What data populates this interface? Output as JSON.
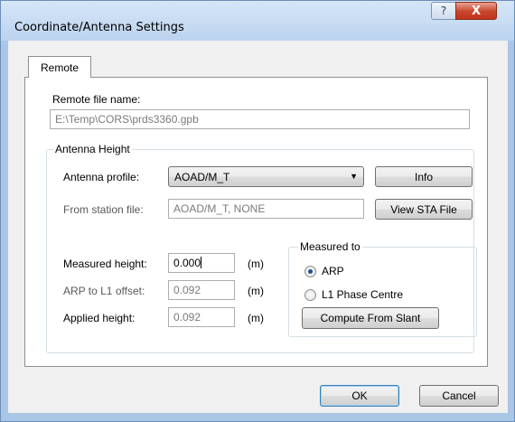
{
  "window": {
    "title": "Coordinate/Antenna Settings",
    "help_button": "?",
    "close_button": "X"
  },
  "tabs": [
    {
      "label": "Remote",
      "active": true
    }
  ],
  "remote": {
    "file_label": "Remote file name:",
    "file_value": "E:\\Temp\\CORS\\prds3360.gpb"
  },
  "antenna_height": {
    "group_title": "Antenna Height",
    "profile_label": "Antenna profile:",
    "profile_value": "AOAD/M_T",
    "info_button": "Info",
    "station_file_label": "From station file:",
    "station_file_value": "AOAD/M_T, NONE",
    "view_sta_button": "View STA File",
    "measured_height_label": "Measured height:",
    "measured_height_value": "0.000",
    "arp_offset_label": "ARP to L1 offset:",
    "arp_offset_value": "0.092",
    "applied_height_label": "Applied height:",
    "applied_height_value": "0.092",
    "unit": "(m)",
    "measured_to": {
      "group_title": "Measured to",
      "options": [
        {
          "label": "ARP",
          "checked": true
        },
        {
          "label": "L1 Phase Centre",
          "checked": false
        }
      ],
      "compute_button": "Compute From Slant"
    }
  },
  "footer": {
    "ok_button": "OK",
    "cancel_button": "Cancel"
  }
}
